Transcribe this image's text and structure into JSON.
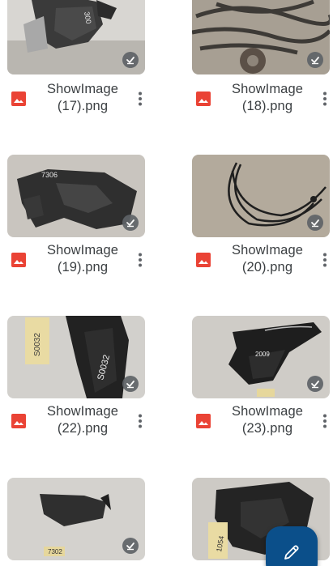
{
  "files": [
    {
      "name_line1": "ShowImage",
      "name_line2": "(17).png",
      "synced": true
    },
    {
      "name_line1": "ShowImage",
      "name_line2": "(18).png",
      "synced": true
    },
    {
      "name_line1": "ShowImage",
      "name_line2": "(19).png",
      "synced": true
    },
    {
      "name_line1": "ShowImage",
      "name_line2": "(20).png",
      "synced": true
    },
    {
      "name_line1": "ShowImage",
      "name_line2": "(22).png",
      "synced": true
    },
    {
      "name_line1": "ShowImage",
      "name_line2": "(23).png",
      "synced": true
    },
    {
      "name_line1": "",
      "name_line2": "",
      "synced": true
    },
    {
      "name_line1": "",
      "name_line2": "",
      "synced": false
    }
  ],
  "thumb_text": {
    "r1c1": "300",
    "r2c1": "7306",
    "r3c1_tag": "S0032",
    "r3c1_part": "S0032",
    "r3c2_part": "2009",
    "r4c1": "7302",
    "r4c2": "1054"
  },
  "colors": {
    "image_type_icon": "#ea4335",
    "fab": "#0b4f8a",
    "text": "#3c4043"
  },
  "icons": {
    "file_type": "image-file-icon",
    "overflow": "more-vert-icon",
    "offline": "offline-check-icon",
    "fab": "pencil-icon"
  }
}
